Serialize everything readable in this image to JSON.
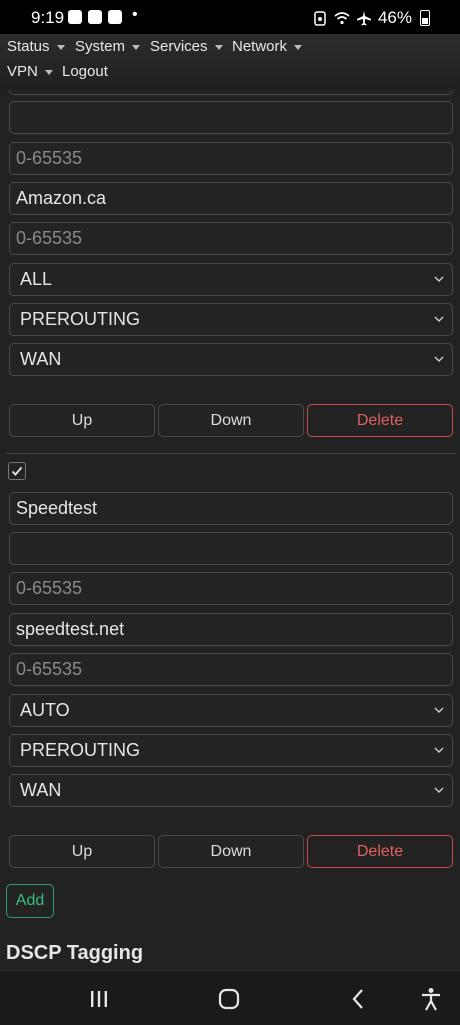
{
  "status_bar": {
    "time": "9:19",
    "dot": "•",
    "battery": "46%",
    "icons": [
      "notification-app-icon",
      "notification-outlook-icon",
      "notification-calendar-icon"
    ]
  },
  "nav": {
    "items": [
      {
        "label": "Status",
        "dropdown": true
      },
      {
        "label": "System",
        "dropdown": true
      },
      {
        "label": "Services",
        "dropdown": true
      },
      {
        "label": "Network",
        "dropdown": true
      },
      {
        "label": "VPN",
        "dropdown": true
      },
      {
        "label": "Logout",
        "dropdown": false
      }
    ]
  },
  "rule1": {
    "name": "",
    "src_port_placeholder": "0-65535",
    "dest_host": "Amazon.ca",
    "dest_port_placeholder": "0-65535",
    "protocol": "ALL",
    "chain": "PREROUTING",
    "interface": "WAN",
    "up_label": "Up",
    "down_label": "Down",
    "delete_label": "Delete"
  },
  "rule2": {
    "enabled": true,
    "name": "Speedtest",
    "src_host": "",
    "src_port_placeholder": "0-65535",
    "dest_host": "speedtest.net",
    "dest_port_placeholder": "0-65535",
    "protocol": "AUTO",
    "chain": "PREROUTING",
    "interface": "WAN",
    "up_label": "Up",
    "down_label": "Down",
    "delete_label": "Delete"
  },
  "add_label": "Add",
  "section_title": "DSCP Tagging",
  "colors": {
    "background": "#222222",
    "border": "#4a4a4a",
    "danger": "#e06060",
    "success": "#3bbf7c"
  }
}
